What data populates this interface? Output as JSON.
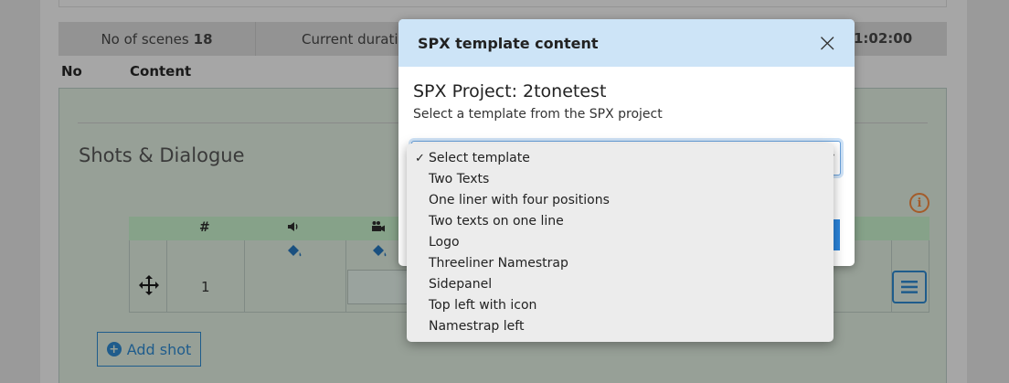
{
  "scene_info": {
    "scenes_label": "No of scenes",
    "scenes_count": "18",
    "duration_label": "Current duratio",
    "duration_value": "1:02:00"
  },
  "columns": {
    "no": "No",
    "content": "Content"
  },
  "section": {
    "title": "Shots & Dialogue"
  },
  "shot_table": {
    "headers": [
      "#"
    ],
    "rows": [
      {
        "number": "1"
      }
    ]
  },
  "add_shot_label": "Add shot",
  "modal": {
    "title": "SPX template content",
    "close_glyph": "×",
    "project_title": "SPX Project: 2tonetest",
    "project_subtitle": "Select a template from the SPX project"
  },
  "dropdown": {
    "selected": "Select template",
    "options": [
      "Select template",
      "Two Texts",
      "One liner with four positions",
      "Two texts on one line",
      "Logo",
      "Threeliner Namestrap",
      "Sidepanel",
      "Top left with icon",
      "Namestrap left"
    ]
  },
  "icons": {
    "close": "close-icon",
    "info": "info-icon",
    "move": "move-icon",
    "speaker": "speaker-icon",
    "camera": "camera-icon",
    "paint": "paint-bucket-icon",
    "menu": "menu-icon",
    "plus": "plus-circle-icon",
    "check": "checkmark-icon"
  },
  "colors": {
    "modal_header": "#cde4f7",
    "accent": "#2b84db",
    "link_blue": "#1f5c8c",
    "info_orange": "#a45c2a"
  }
}
